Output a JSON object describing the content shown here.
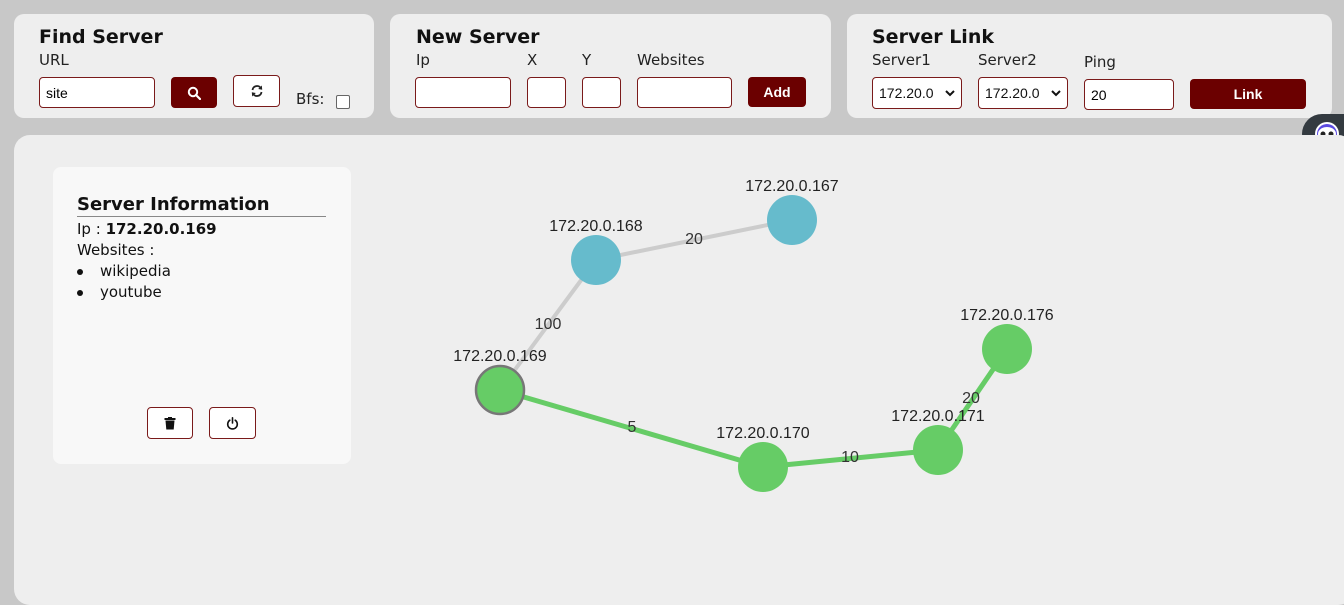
{
  "find_server": {
    "title": "Find Server",
    "url_label": "URL",
    "url_value": "site",
    "bfs_label": "Bfs:",
    "bfs_checked": false,
    "search_icon": "search-icon",
    "refresh_icon": "refresh-icon"
  },
  "new_server": {
    "title": "New Server",
    "ip_label": "Ip",
    "x_label": "X",
    "y_label": "Y",
    "websites_label": "Websites",
    "add_label": "Add"
  },
  "server_link": {
    "title": "Server Link",
    "server1_label": "Server1",
    "server2_label": "Server2",
    "ping_label": "Ping",
    "server1_value": "172.20.0",
    "server2_value": "172.20.0",
    "ping_value": "20",
    "link_label": "Link"
  },
  "server_info": {
    "title": "Server Information",
    "ip_prefix": "Ip :",
    "ip_value": "172.20.0.169",
    "websites_label": "Websites :",
    "websites": [
      "wikipedia",
      "youtube"
    ],
    "delete_icon": "trash-icon",
    "power_icon": "power-icon"
  },
  "colors": {
    "accent": "#6b0000",
    "node_active": "#66cc66",
    "node_inactive": "#66bbcc",
    "edge_active": "#66cc66",
    "edge_inactive": "#cccccc"
  },
  "graph": {
    "nodes": [
      {
        "id": "172.20.0.167",
        "label": "172.20.0.167",
        "status": "inactive"
      },
      {
        "id": "172.20.0.168",
        "label": "172.20.0.168",
        "status": "inactive"
      },
      {
        "id": "172.20.0.169",
        "label": "172.20.0.169",
        "status": "active",
        "selected": true
      },
      {
        "id": "172.20.0.170",
        "label": "172.20.0.170",
        "status": "active"
      },
      {
        "id": "172.20.0.171",
        "label": "172.20.0.171",
        "status": "active"
      },
      {
        "id": "172.20.0.176",
        "label": "172.20.0.176",
        "status": "active"
      }
    ],
    "edges": [
      {
        "from": "172.20.0.168",
        "to": "172.20.0.167",
        "ping": "20",
        "status": "inactive"
      },
      {
        "from": "172.20.0.169",
        "to": "172.20.0.168",
        "ping": "100",
        "status": "inactive"
      },
      {
        "from": "172.20.0.169",
        "to": "172.20.0.170",
        "ping": "5",
        "status": "active"
      },
      {
        "from": "172.20.0.170",
        "to": "172.20.0.171",
        "ping": "10",
        "status": "active"
      },
      {
        "from": "172.20.0.171",
        "to": "172.20.0.176",
        "ping": "20",
        "status": "active"
      }
    ]
  }
}
